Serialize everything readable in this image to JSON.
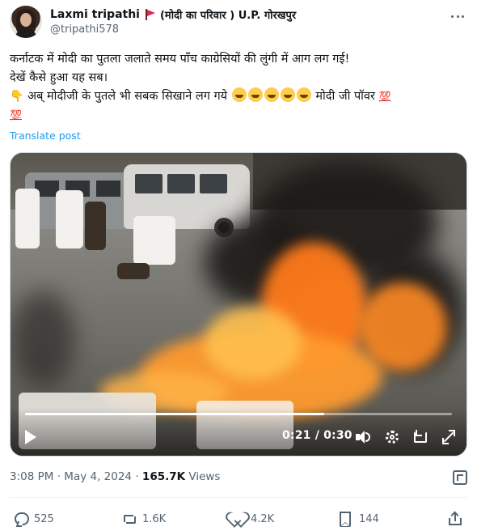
{
  "author": {
    "display_name": "Laxmi tripathi",
    "name_suffix": "(मोदी का परिवार ) U.P. गोरखपुर",
    "handle": "@tripathi578"
  },
  "tweet": {
    "line1": "कर्नाटक में मोदी का पुतला जलाते समय पाँच काग्रेसियों की लुंगी में आग लग गई!",
    "line2": "देखें कैसे हुआ यह सब।",
    "line3_text": "अब् मोदीजी के पुतले भी सबक सिखाने लग गये",
    "line3_tail": "मोदी जी पॉवर",
    "hundred_mark": "💯",
    "translate_label": "Translate post"
  },
  "video": {
    "current_time": "0:21",
    "separator": "/",
    "duration": "0:30",
    "progress_fraction": 0.7
  },
  "meta": {
    "time": "3:08 PM",
    "dot1": "·",
    "date": "May 4, 2024",
    "dot2": "·",
    "views_count": "165.7K",
    "views_label": "Views"
  },
  "actions": {
    "replies": "525",
    "reposts": "1.6K",
    "likes": "4.2K",
    "bookmarks": "144"
  },
  "colors": {
    "link": "#1d9bf0",
    "secondary_text": "#536471",
    "flag": "#e0245e"
  },
  "icons": [
    "more-icon",
    "play-icon",
    "volume-icon",
    "settings-icon",
    "pip-icon",
    "fullscreen-icon",
    "grok-icon",
    "reply-icon",
    "retweet-icon",
    "like-icon",
    "bookmark-icon",
    "share-icon",
    "flag-icon",
    "rofl-emoji",
    "point-down-emoji"
  ]
}
